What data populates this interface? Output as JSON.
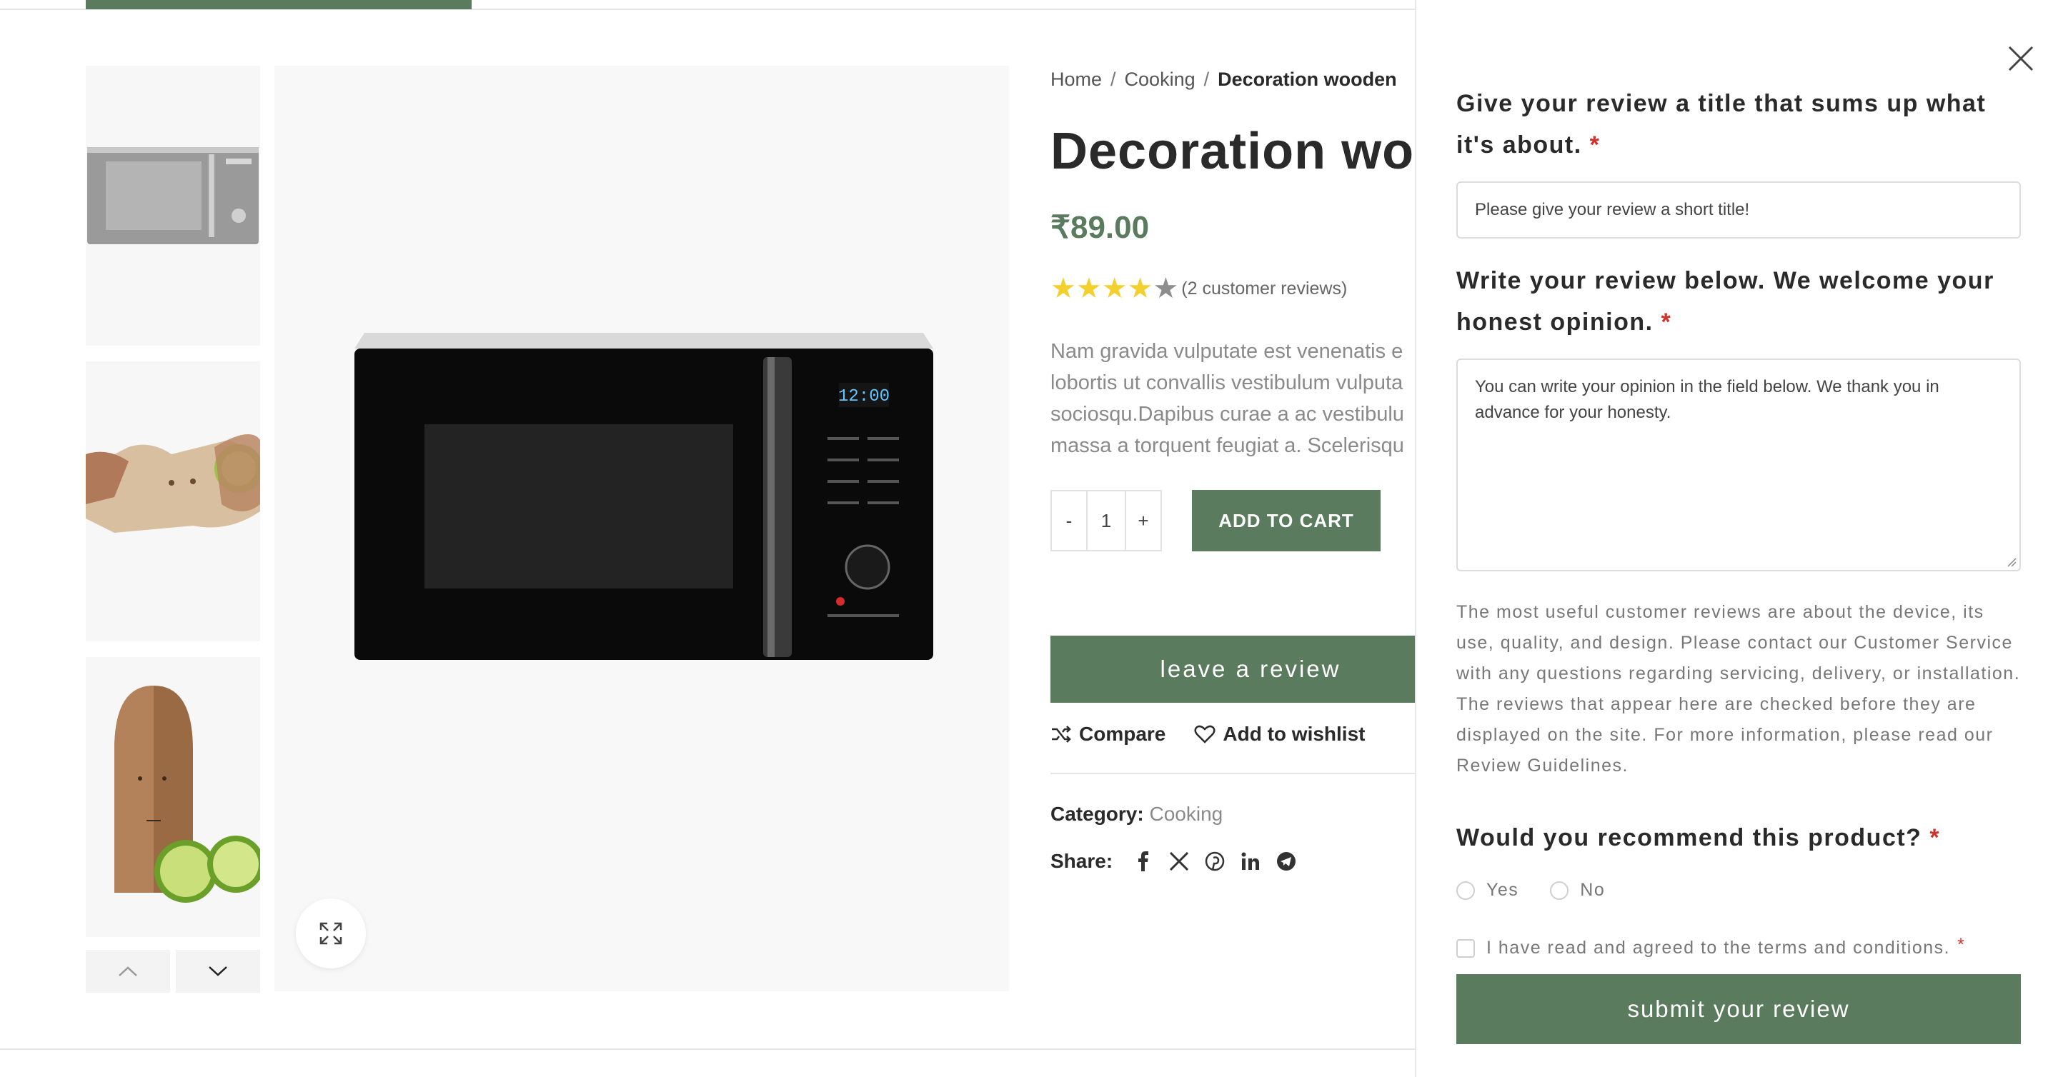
{
  "breadcrumb": {
    "home": "Home",
    "category": "Cooking",
    "current": "Decoration wooden"
  },
  "product": {
    "title": "Decoration woo",
    "price": "₹89.00",
    "rating_stars": 4,
    "rating_max": 5,
    "reviews_text": "(2 customer reviews)",
    "description_lines": [
      "Nam gravida vulputate est venenatis e",
      "lobortis ut convallis vestibulum vulputa",
      "sociosqu.Dapibus curae a ac vestibulu",
      "massa a torquent feugiat a. Scelerisqu"
    ],
    "quantity": "1",
    "qty_minus": "-",
    "qty_plus": "+",
    "add_to_cart": "ADD TO CART",
    "leave_review": "leave a review",
    "compare": "Compare",
    "wishlist": "Add to wishlist",
    "category_label": "Category:",
    "category_value": "Cooking",
    "share_label": "Share:",
    "share_icons": [
      "facebook-icon",
      "x-icon",
      "pinterest-icon",
      "linkedin-icon",
      "telegram-icon"
    ]
  },
  "review_panel": {
    "title_question": "Give your review a title that sums up what it's about.",
    "title_placeholder": "Please give your review a short title!",
    "body_question": "Write your review below. We welcome your honest opinion.",
    "body_placeholder": "You can write your opinion in the field below. We thank you in advance for your honesty.",
    "help_text": "The most useful customer reviews are about the device, its use, quality, and design. Please contact our Customer Service with any questions regarding servicing, delivery, or installation. The reviews that appear here are checked before they are displayed on the site. For more information, please read our Review Guidelines.",
    "recommend_question": "Would you recommend this product?",
    "recommend_yes": "Yes",
    "recommend_no": "No",
    "terms_label": "I have read and agreed to the terms and conditions.",
    "submit": "submit your review",
    "required_mark": "*"
  },
  "colors": {
    "accent": "#5b7b5e",
    "star": "#f4d02f",
    "required": "#d0312d"
  }
}
